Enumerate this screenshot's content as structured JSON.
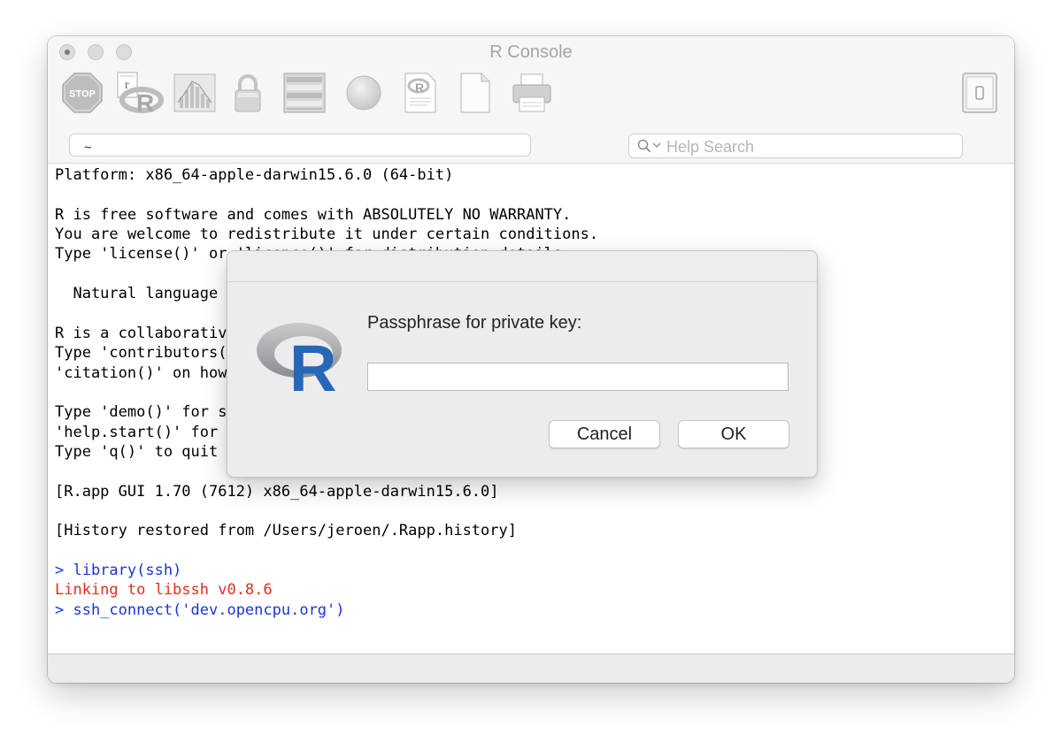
{
  "window": {
    "title": "R Console"
  },
  "toolbar": {
    "items": [
      {
        "name": "stop-icon",
        "label": "STOP"
      },
      {
        "name": "source-script-icon",
        "logo_letter": "R",
        "badge": "r"
      },
      {
        "name": "quartz-graphics-icon"
      },
      {
        "name": "lock-icon"
      },
      {
        "name": "workspace-browser-icon"
      },
      {
        "name": "circle-icon"
      },
      {
        "name": "help-document-icon"
      },
      {
        "name": "new-document-icon"
      },
      {
        "name": "print-icon"
      }
    ],
    "drawer_toggle": {
      "name": "drawer-toggle-icon"
    }
  },
  "path_field": {
    "value": "~"
  },
  "search": {
    "placeholder": "Help Search"
  },
  "console_lines": [
    {
      "text": "Platform: x86_64-apple-darwin15.6.0 (64-bit)",
      "color": "black"
    },
    {
      "text": "",
      "color": "black"
    },
    {
      "text": "R is free software and comes with ABSOLUTELY NO WARRANTY.",
      "color": "black"
    },
    {
      "text": "You are welcome to redistribute it under certain conditions.",
      "color": "black"
    },
    {
      "text": "Type 'license()' or 'licence()' for distribution details.",
      "color": "black"
    },
    {
      "text": "",
      "color": "black"
    },
    {
      "text": "  Natural language",
      "color": "black"
    },
    {
      "text": "",
      "color": "black"
    },
    {
      "text": "R is a collaborativ",
      "color": "black"
    },
    {
      "text": "Type 'contributors(",
      "color": "black"
    },
    {
      "text": "'citation()' on how",
      "color": "black"
    },
    {
      "text": "",
      "color": "black"
    },
    {
      "text": "Type 'demo()' for s",
      "color": "black"
    },
    {
      "text": "'help.start()' for",
      "color": "black"
    },
    {
      "text": "Type 'q()' to quit",
      "color": "black"
    },
    {
      "text": "",
      "color": "black"
    },
    {
      "text": "[R.app GUI 1.70 (7612) x86_64-apple-darwin15.6.0]",
      "color": "black"
    },
    {
      "text": "",
      "color": "black"
    },
    {
      "text": "[History restored from /Users/jeroen/.Rapp.history]",
      "color": "black"
    },
    {
      "text": "",
      "color": "black"
    },
    {
      "text": "> library(ssh)",
      "color": "blue"
    },
    {
      "text": "Linking to libssh v0.8.6",
      "color": "red"
    },
    {
      "text": "> ssh_connect('dev.opencpu.org')",
      "color": "blue"
    }
  ],
  "dialog": {
    "logo_letter": "R",
    "prompt": "Passphrase for private key:",
    "input_value": "",
    "cancel_label": "Cancel",
    "ok_label": "OK"
  },
  "colors": {
    "prompt_blue": "#1c35d5",
    "message_red": "#e0301e",
    "r_logo_blue": "#2468b8",
    "r_logo_gray": "#a3a4a8"
  }
}
